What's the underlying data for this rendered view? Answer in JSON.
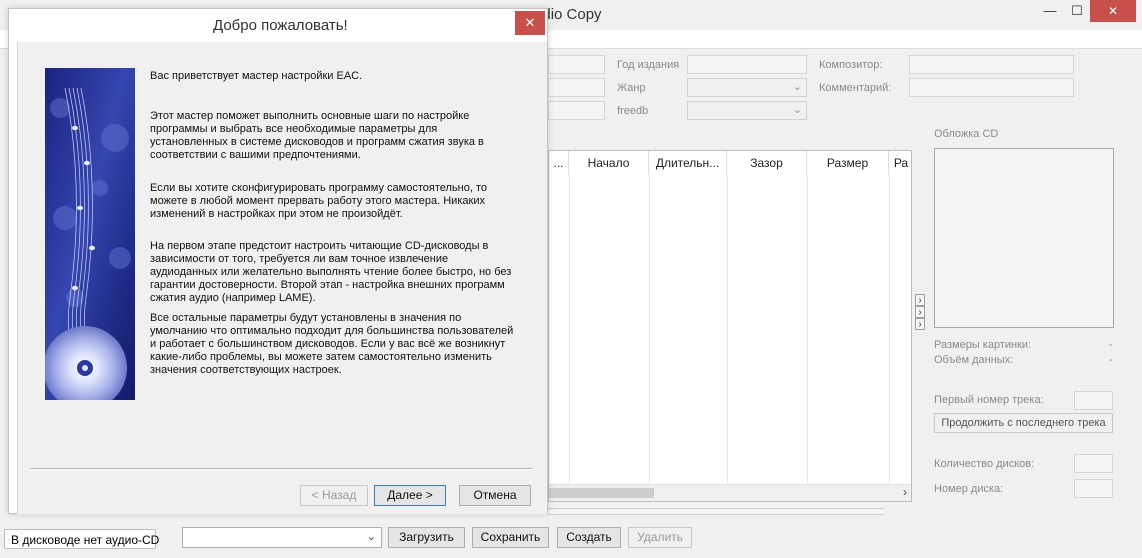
{
  "app": {
    "title": "Exact Audio Copy",
    "title_visible": "Audio Copy",
    "window_controls": {
      "minimize": "—",
      "maximize": "☐",
      "close": "✕"
    }
  },
  "metadata_fields": {
    "year_label": "Год издания",
    "genre_label": "Жанр",
    "freedb_label": "freedb",
    "composer_label": "Композитор:",
    "comment_label": "Комментарий:"
  },
  "table": {
    "columns": [
      "...",
      "Начало",
      "Длительн...",
      "Зазор",
      "Размер",
      "Ра"
    ],
    "scroll_right": "›"
  },
  "cover": {
    "title": "Обложка CD",
    "size_label": "Размеры картинки:",
    "size_value": "-",
    "volume_label": "Объём данных:",
    "volume_value": "-"
  },
  "track": {
    "first_track_label": "Первый номер трека:",
    "continue_button": "Продолжить с последнего трека",
    "disc_count_label": "Количество дисков:",
    "disc_number_label": "Номер диска:"
  },
  "expander_icon": "›",
  "statusbar": {
    "status_text": "В дисководе нет аудио-CD",
    "load": "Загрузить",
    "save": "Сохранить",
    "create": "Создать",
    "delete": "Удалить"
  },
  "wizard": {
    "title": "Добро пожаловать!",
    "close": "✕",
    "paragraphs": [
      [
        "Вас приветствует мастер настройки EAC."
      ],
      [
        "Этот мастер поможет выполнить основные шаги по настройке",
        "программы и выбрать все необходимые параметры для",
        "установленных в системе дисководов и программ сжатия звука в",
        "соответствии с вашими предпочтениями."
      ],
      [
        "Если вы хотите сконфигурировать программу самостоятельно, то",
        "можете в любой момент прервать работу этого мастера. Никаких",
        "изменений в настройках при этом не произойдёт."
      ],
      [
        "На первом этапе предстоит настроить читающие CD-дисководы в",
        "зависимости от того, требуется ли вам точное извлечение",
        "аудиоданных или желательно выполнять чтение более быстро, но без",
        "гарантии достоверности. Второй этап - настройка внешних программ",
        "сжатия аудио (например LAME)."
      ],
      [
        "Все остальные параметры будут установлены в значения по",
        "умолчанию что оптимально подходит для большинства пользователей",
        "и работает с большинством дисководов. Если у вас всё же возникнут",
        "какие-либо проблемы, вы можете затем самостоятельно изменить",
        "значения соответствующих настроек."
      ]
    ],
    "back_button": "< Назад",
    "next_button": "Далее >",
    "cancel_button": "Отмена"
  },
  "colors": {
    "close_red": "#c7504b",
    "image_blue": "#2a3a9c"
  }
}
